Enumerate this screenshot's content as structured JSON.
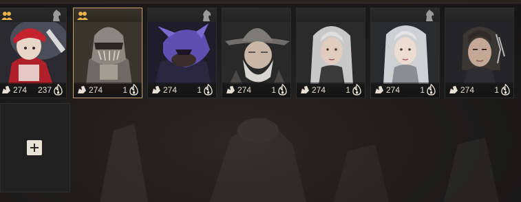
{
  "characters": [
    {
      "gear_score": "274",
      "level": "237",
      "badge": "group-badge-icon",
      "knight": "knight-icon",
      "selected": false
    },
    {
      "gear_score": "274",
      "level": "1",
      "badge": "group-badge-icon",
      "knight": "",
      "selected": true
    },
    {
      "gear_score": "274",
      "level": "1",
      "badge": "",
      "knight": "knight-icon",
      "selected": false
    },
    {
      "gear_score": "274",
      "level": "1",
      "badge": "",
      "knight": "",
      "selected": false
    },
    {
      "gear_score": "274",
      "level": "1",
      "badge": "",
      "knight": "",
      "selected": false
    },
    {
      "gear_score": "274",
      "level": "1",
      "badge": "",
      "knight": "knight-icon",
      "selected": false
    },
    {
      "gear_score": "274",
      "level": "1",
      "badge": "",
      "knight": "",
      "selected": false
    }
  ],
  "add_slot": {
    "icon": "plus-icon"
  },
  "colors": {
    "accent": "#c9a46a",
    "card_bg": "#202020",
    "text": "#e6e0d4",
    "badge": "#e9b44a"
  }
}
